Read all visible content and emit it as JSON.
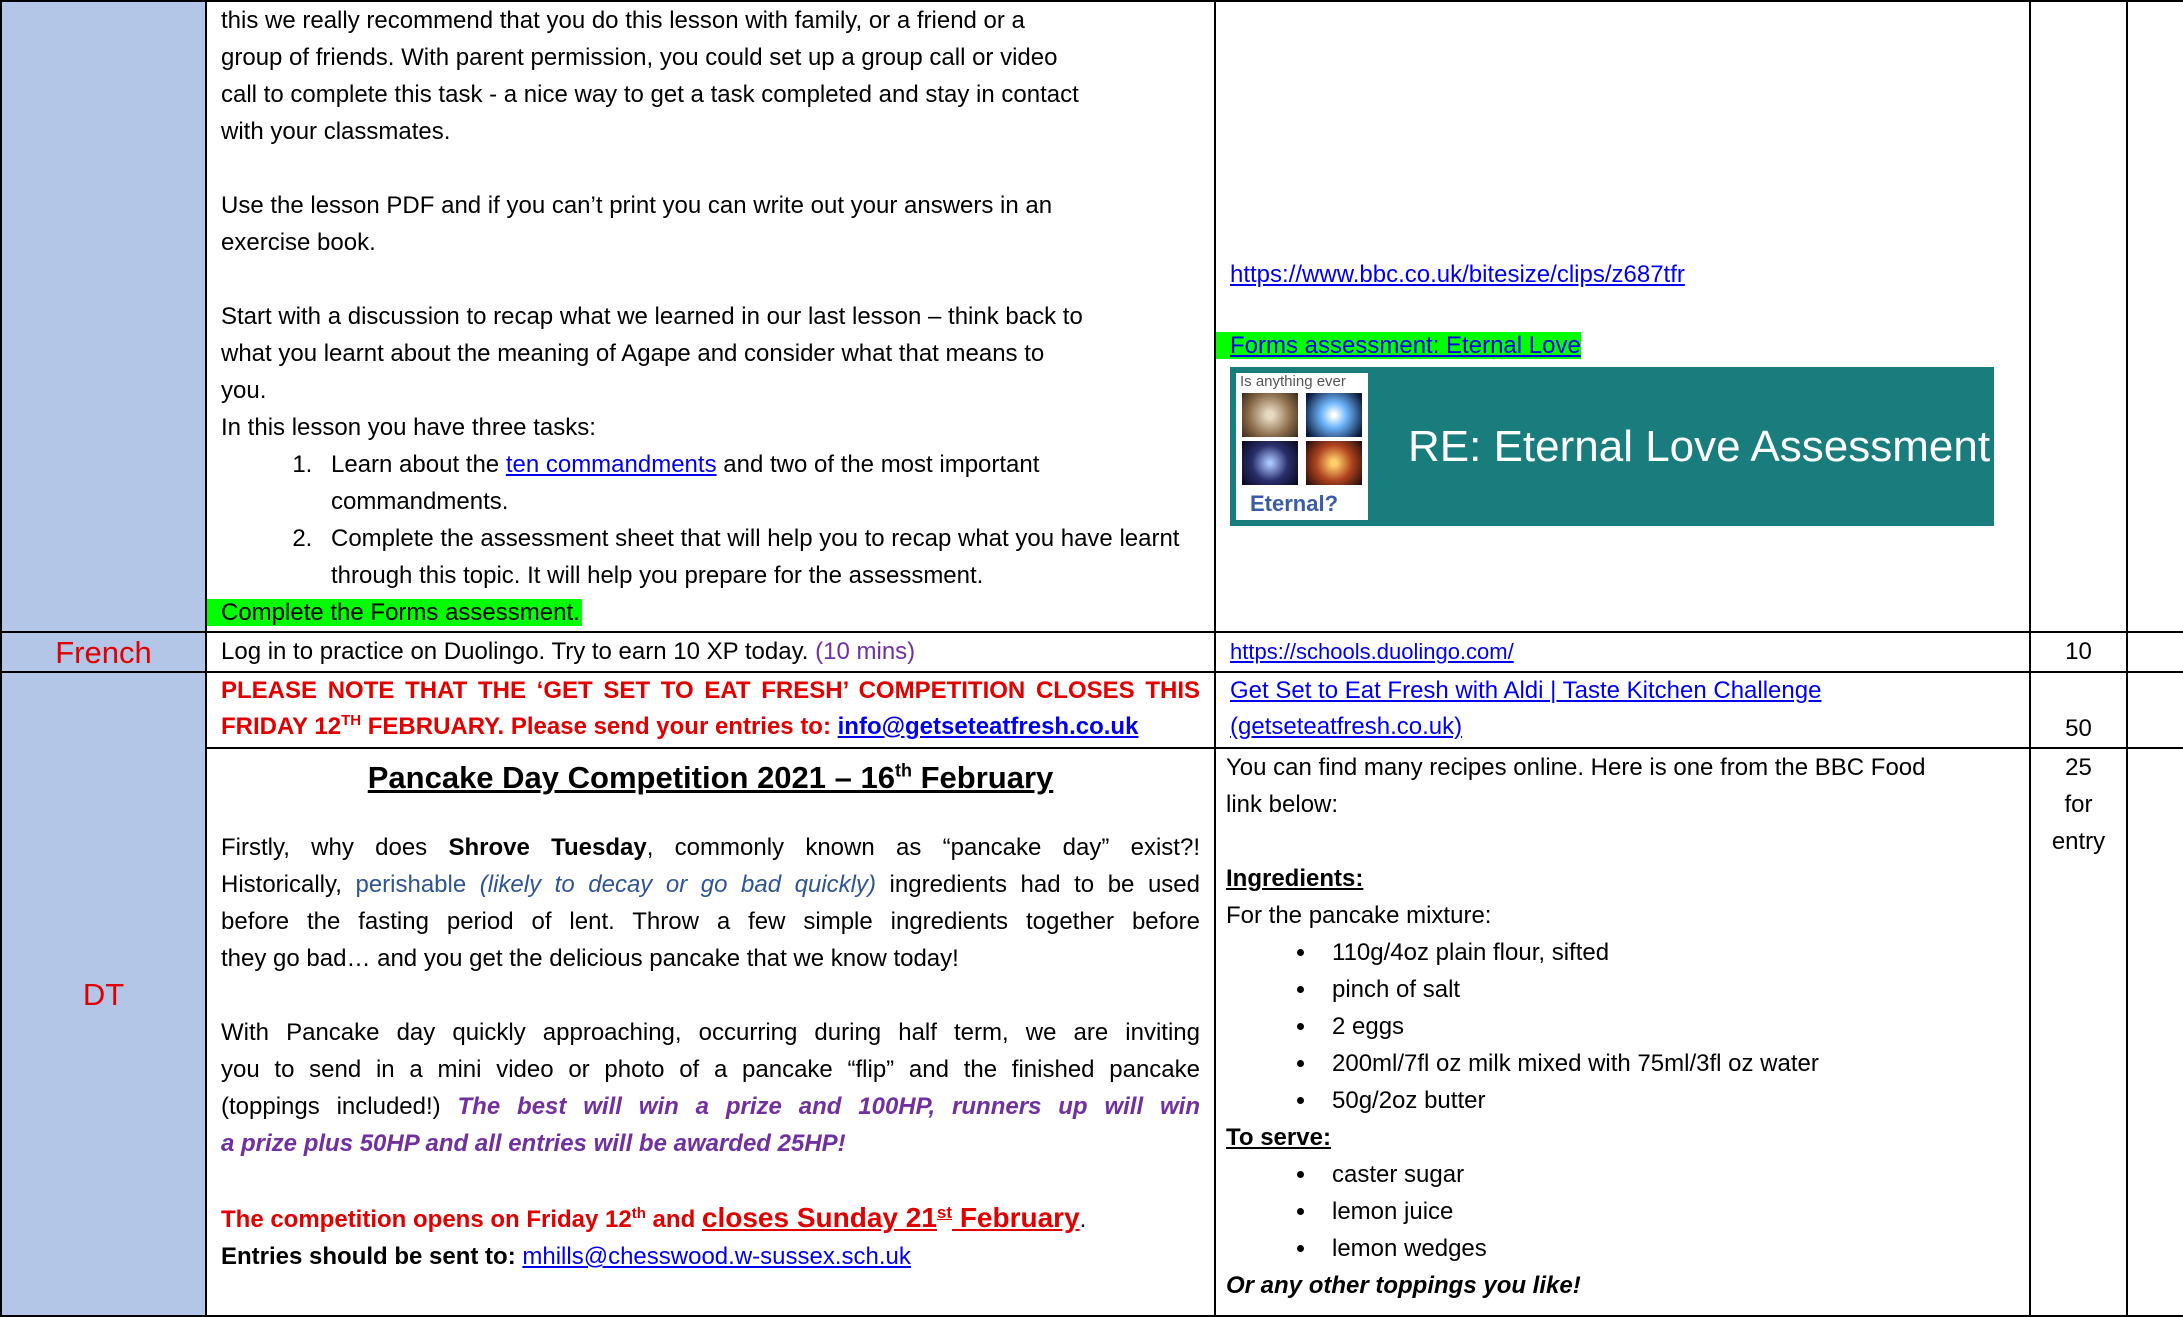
{
  "re": {
    "lines_intro": [
      "this we really recommend that you do this lesson with family, or a friend or a",
      "group of friends. With parent permission, you could set up a group call or video",
      "call to complete this task - a nice way to get a task completed and stay in contact",
      "with your classmates."
    ],
    "lines_pdf": [
      "Use the lesson PDF and if you can’t print you can write out your answers in an",
      "exercise book."
    ],
    "lines_start": [
      "Start with a discussion to recap what we learned in our last lesson – think back to",
      "what you learnt about the meaning of Agape and consider what that means to",
      "you.",
      "In this lesson you have three tasks:"
    ],
    "task1_pre": "Learn about the ",
    "task1_link": "ten commandments",
    "task1_post": " and two of the most important commandments.",
    "task2": "Complete the assessment sheet that will help you to recap what you have learnt through this topic. It will help you prepare for the assessment.",
    "task3": "Complete the Forms assessment.",
    "bbc_link": "https://www.bbc.co.uk/bitesize/clips/z687tfr",
    "forms_link": "Forms assessment: Eternal Love",
    "banner_title": "RE: Eternal Love Assessment",
    "thumb_top": "Is anything ever",
    "thumb_bottom": "Eternal?"
  },
  "french": {
    "subject": "French",
    "text": "Log in to practice on Duolingo. Try to earn 10 XP today.",
    "time": "(10 mins)",
    "link": "https://schools.duolingo.com/",
    "hp": "10"
  },
  "dt": {
    "subject": "DT",
    "notice_line1": "PLEASE NOTE THAT THE ‘GET SET TO EAT FRESH’ COMPETITION CLOSES THIS",
    "notice_line2_pre": "FRIDAY 12",
    "notice_line2_sup": "TH",
    "notice_line2_post": " FEBRUARY. Please send your entries to: ",
    "notice_email": "info@getseteatfresh.co.uk",
    "aldi_link_line1": "Get Set to Eat Fresh with Aldi | Taste Kitchen Challenge",
    "aldi_link_line2": "(getseteatfresh.co.uk)",
    "aldi_hp": "50",
    "pancake_title_pre": "Pancake Day Competition 2021 – 16",
    "pancake_title_sup": "th",
    "pancake_title_post": " February",
    "p1_a": "Firstly, why does ",
    "p1_bold": "Shrove Tuesday",
    "p1_b": ", commonly known as “pancake day” exist?!",
    "p2_a": "Historically, ",
    "p2_word": "perishable",
    "p2_italic": " (likely to decay or go bad quickly)",
    "p2_b": " ingredients had to be used",
    "p3": "before the fasting period of lent. Throw a few simple ingredients together before",
    "p4": "they go bad… and you get the delicious pancake that we know today!",
    "p5": "With Pancake day quickly approaching, occurring during half term, we are inviting",
    "p6": "you to send in a mini video or photo of a pancake “flip” and the finished pancake",
    "p7_a": "(toppings included!) ",
    "p7_purple": "The best will win a prize and 100HP, runners up will win",
    "p8_purple": "a prize plus 50HP and all entries will be awarded 25HP!",
    "opens_a": "The competition opens on Friday 12",
    "opens_sup": "th",
    "opens_b": " and ",
    "closes_a": "closes Sunday 21",
    "closes_sup": "st",
    "closes_b": " February",
    "closes_dot": ".",
    "entries_label": "Entries should be sent to:",
    "entries_email": "mhills@chesswood.w-sussex.sch.uk",
    "recipe_intro_1": "You can find many recipes online. Here is one from the BBC Food",
    "recipe_intro_2": "link below:",
    "ingredients_heading": "Ingredients:",
    "mixture_label": "For the pancake mixture:",
    "ingredients": [
      "110g/4oz plain flour, sifted",
      "pinch of salt",
      "2 eggs",
      "200ml/7fl oz milk mixed with 75ml/3fl oz water",
      "50g/2oz butter"
    ],
    "serve_heading": "To serve:",
    "serve": [
      "caster sugar",
      "lemon juice",
      "lemon wedges"
    ],
    "toppings": "Or any other toppings you like!",
    "entry_hp": [
      "25",
      "for",
      "entry"
    ]
  }
}
